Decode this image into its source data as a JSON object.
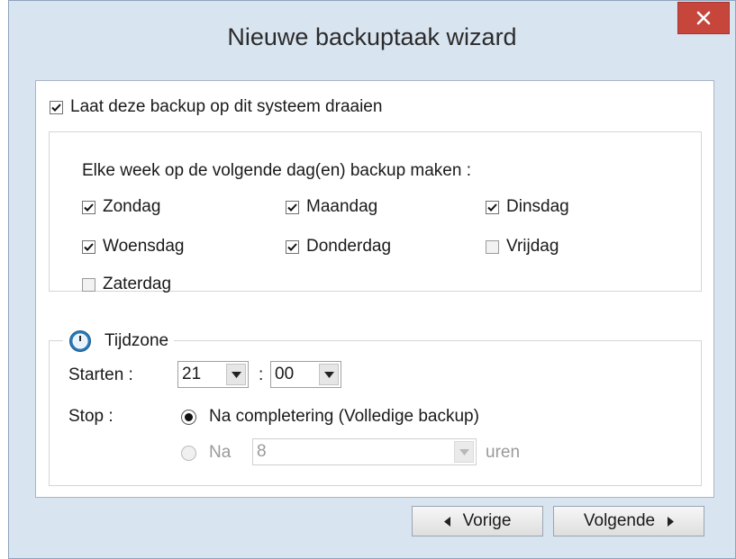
{
  "window": {
    "title": "Nieuwe backuptaak wizard"
  },
  "main_checkbox": {
    "label": "Laat deze backup op dit systeem draaien",
    "checked": true
  },
  "days": {
    "heading": "Elke week op de volgende dag(en) backup maken :",
    "items": [
      {
        "label": "Zondag",
        "checked": true
      },
      {
        "label": "Maandag",
        "checked": true
      },
      {
        "label": "Dinsdag",
        "checked": true
      },
      {
        "label": "Woensdag",
        "checked": true
      },
      {
        "label": "Donderdag",
        "checked": true
      },
      {
        "label": "Vrijdag",
        "checked": false
      },
      {
        "label": "Zaterdag",
        "checked": false
      }
    ]
  },
  "time": {
    "legend": "Tijdzone",
    "start_label": "Starten :",
    "hour": "21",
    "separator": ":",
    "minute": "00",
    "stop_label": "Stop :",
    "option_complete": "Na completering (Volledige backup)",
    "option_after_prefix": "Na",
    "after_hours": "8",
    "after_unit": "uren"
  },
  "buttons": {
    "back": "Vorige",
    "next": "Volgende"
  },
  "icons": {
    "close": "close-icon",
    "clock": "clock-icon",
    "arrow_left": "arrow-left-icon",
    "arrow_right": "arrow-right-icon"
  },
  "colors": {
    "window_bg": "#d9e4f1",
    "close_btn": "#c7463c",
    "clock_accent": "#2b7bb9"
  }
}
